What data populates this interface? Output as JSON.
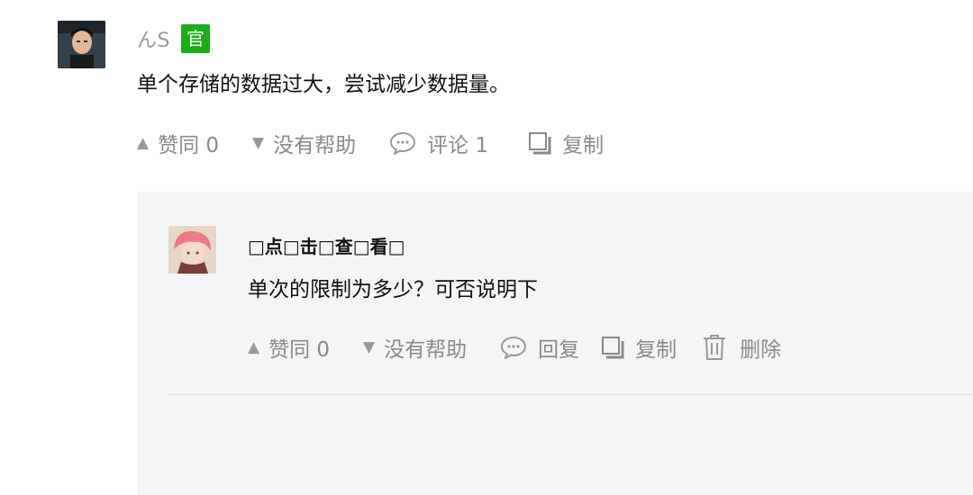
{
  "answer": {
    "author": "んS",
    "badge": "官",
    "text": "单个存储的数据过大，尝试减少数据量。",
    "actions": {
      "upvote": "赞同 0",
      "downvote": "没有帮助",
      "comment": "评论 1",
      "copy": "复制"
    }
  },
  "reply": {
    "author": "□点□击□查□看□",
    "text": "单次的限制为多少？可否说明下",
    "actions": {
      "upvote": "赞同 0",
      "downvote": "没有帮助",
      "reply": "回复",
      "copy": "复制",
      "delete": "删除"
    }
  }
}
